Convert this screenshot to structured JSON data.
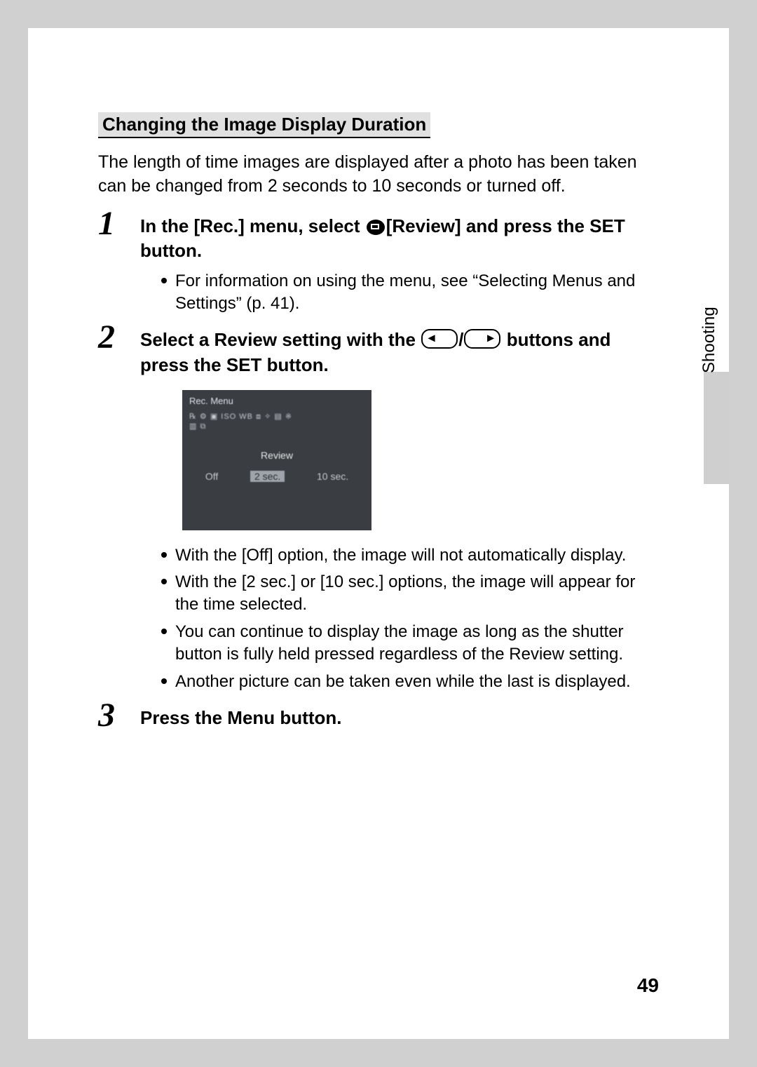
{
  "section_title": "Changing the Image Display Duration",
  "intro": "The length of time images are displayed after a photo has been taken can be changed from 2 seconds to 10 seconds or turned off.",
  "side_label": "Shooting",
  "page_number": "49",
  "steps": {
    "s1": {
      "num": "1",
      "head_pre": "In the [Rec.] menu, select ",
      "head_mid": "[Review] and press the SET button.",
      "bullets": [
        "For information on using the menu, see “Selecting Menus and Settings” (p. 41)."
      ]
    },
    "s2": {
      "num": "2",
      "head_pre": "Select a Review setting with the ",
      "head_slash": "/",
      "head_post": " buttons and press the SET button.",
      "bullets": [
        "With the [Off] option, the image will not automatically display.",
        "With the [2 sec.] or [10 sec.] options, the image will appear for the time selected.",
        "You can continue to display the image as long as the shutter button is fully held pressed regardless of the Review setting.",
        "Another picture can be taken even while the last is displayed."
      ]
    },
    "s3": {
      "num": "3",
      "head": "Press the Menu button."
    }
  },
  "lcd": {
    "title": "Rec. Menu",
    "iconrow": "℞ ⚙ ▣ ISO WB ⧈ ✧ ▤ ※",
    "iconrow2": "▥ ⧉",
    "label": "Review",
    "options": {
      "o1": "Off",
      "o2": "2 sec.",
      "o3": "10 sec."
    }
  }
}
